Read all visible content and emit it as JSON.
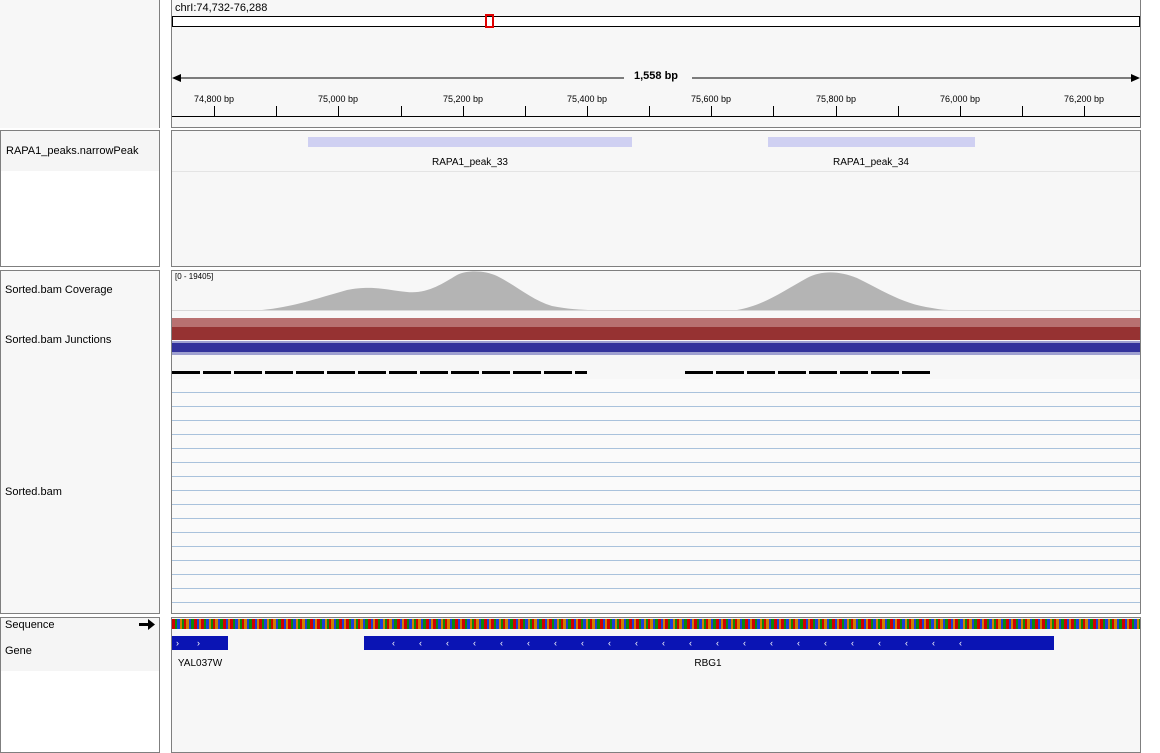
{
  "locus": {
    "text": "chrI:74,732-76,288"
  },
  "ruler": {
    "span_label": "1,558 bp",
    "ticks": [
      "74,800 bp",
      "75,000 bp",
      "75,200 bp",
      "75,400 bp",
      "75,600 bp",
      "75,800 bp",
      "76,000 bp",
      "76,200 bp"
    ]
  },
  "tracks": {
    "peaks": {
      "name": "RAPA1_peaks.narrowPeak",
      "features": [
        {
          "label": "RAPA1_peak_33"
        },
        {
          "label": "RAPA1_peak_34"
        }
      ],
      "color": "#cfd0f2"
    },
    "coverage": {
      "name": "Sorted.bam Coverage",
      "range": "[0 - 19405]",
      "color": "#b4b4b4"
    },
    "junctions": {
      "name": "Sorted.bam Junctions",
      "forward_color": "#963232",
      "reverse_color": "#32329b"
    },
    "alignments": {
      "name": "Sorted.bam",
      "row_color": "#a9c2dc"
    },
    "sequence": {
      "name": "Sequence",
      "strand_icon": "arrow-right-icon"
    },
    "gene": {
      "name": "Gene",
      "features": [
        {
          "label": "YAL037W",
          "strand": "+"
        },
        {
          "label": "RBG1",
          "strand": "-"
        }
      ],
      "color": "#0a14b4"
    }
  }
}
